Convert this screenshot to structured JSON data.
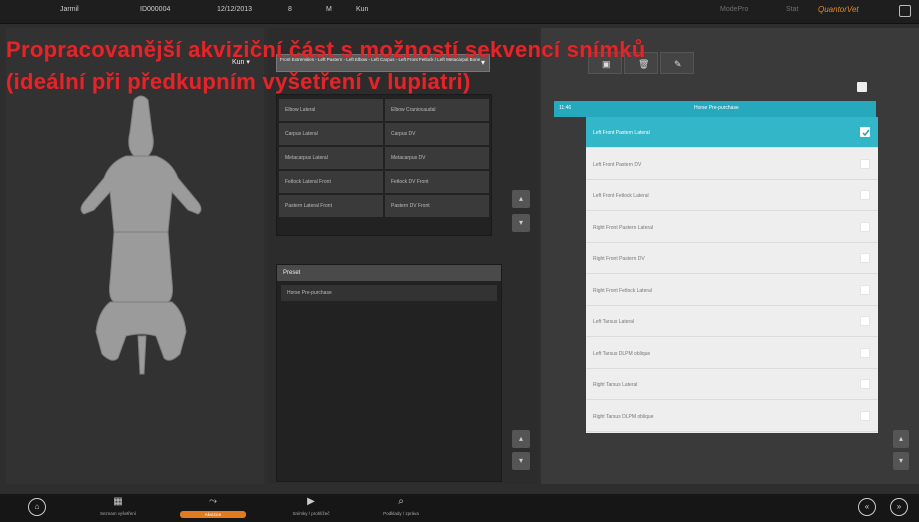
{
  "topbar": {
    "patient_name": "Jarmil",
    "patient_id": "ID000004",
    "date": "12/12/2013",
    "age": "8",
    "sex": "M",
    "species": "Kun",
    "right_dim_1": "ModePro",
    "right_dim_2": "Stat",
    "brand": "QuantorVet"
  },
  "overlay_text": "Propracovanější akviziční část s možností sekvencí snímků (ideální při předkupním vyšetření v lupiatri)",
  "species_selector": "Kun",
  "projection_select": {
    "text": "Front Extremities - Left Pastern - Left Elbow - Left Carpus - Left Front Fetlock / Left Metacarpal Bone"
  },
  "projections": [
    {
      "label": "Elbow Lateral"
    },
    {
      "label": "Elbow Craniocaudal"
    },
    {
      "label": "Carpus Lateral"
    },
    {
      "label": "Carpus DV"
    },
    {
      "label": "Metacarpus Lateral"
    },
    {
      "label": "Metacarpus DV"
    },
    {
      "label": "Fetlock Lateral Front"
    },
    {
      "label": "Fetlock DV Front"
    },
    {
      "label": "Pastern Lateral Front"
    },
    {
      "label": "Pastern DV Front"
    }
  ],
  "preset": {
    "header": "Preset",
    "items": [
      {
        "label": "Horse Pre-purchase"
      }
    ]
  },
  "toolbar": {
    "save_icon": "save-icon",
    "delete_icon": "trash-icon",
    "edit_icon": "pencil-icon"
  },
  "sequence": {
    "number": "11:46",
    "title": "Horse Pre-purchase",
    "items": [
      {
        "label": "Left Front Pastern Lateral",
        "checked": true,
        "active": true
      },
      {
        "label": "Left Front Pastern DV",
        "checked": false,
        "active": false
      },
      {
        "label": "Left Front Fetlock Lateral",
        "checked": false,
        "active": false
      },
      {
        "label": "Right Front Pastern Lateral",
        "checked": false,
        "active": false
      },
      {
        "label": "Right Front Pastern DV",
        "checked": false,
        "active": false
      },
      {
        "label": "Right Front Fetlock Lateral",
        "checked": false,
        "active": false
      },
      {
        "label": "Left Tarsus Lateral",
        "checked": false,
        "active": false
      },
      {
        "label": "Left Tarsus DLPM oblique",
        "checked": false,
        "active": false
      },
      {
        "label": "Right Tarsus Lateral",
        "checked": false,
        "active": false
      },
      {
        "label": "Right Tarsus DLPM oblique",
        "checked": false,
        "active": false
      }
    ]
  },
  "bottom_nav": [
    {
      "label": "Seznam vyšetření",
      "icon": "image-list-icon",
      "selected": false
    },
    {
      "label": "Akvizice",
      "icon": "xray-tube-icon",
      "selected": true
    },
    {
      "label": "Snímky / prohlížeč",
      "icon": "play-icon",
      "selected": false
    },
    {
      "label": "Podklady / zpráva",
      "icon": "document-search-icon",
      "selected": false
    }
  ],
  "colors": {
    "accent": "#26a8bd",
    "overlay_red": "#e0262b",
    "selected_nav": "#e07b22"
  }
}
